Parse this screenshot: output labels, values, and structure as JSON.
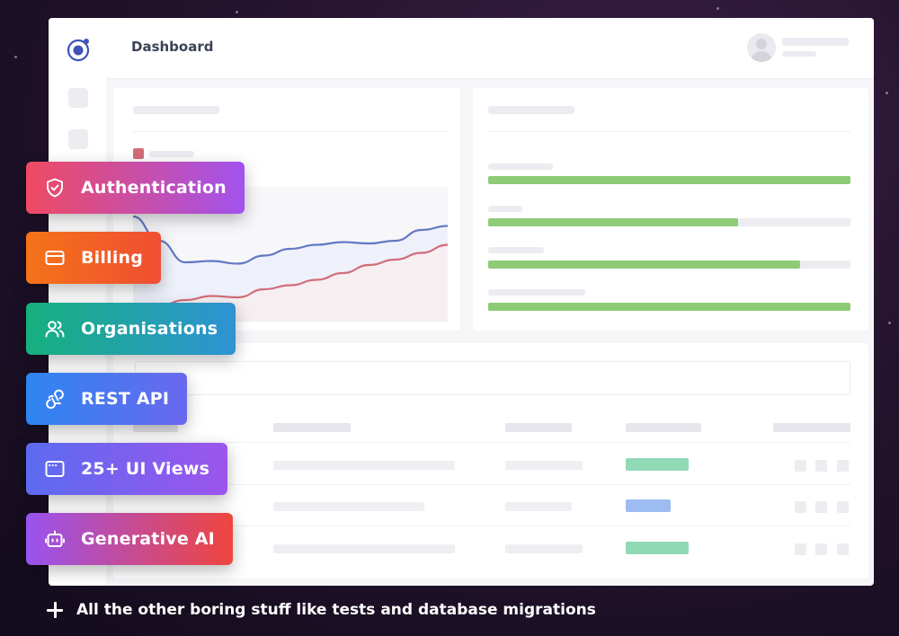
{
  "dashboard": {
    "title": "Dashboard"
  },
  "features": [
    {
      "label": "Authentication",
      "icon": "shield-check-icon"
    },
    {
      "label": "Billing",
      "icon": "credit-card-icon"
    },
    {
      "label": "Organisations",
      "icon": "users-icon"
    },
    {
      "label": "REST API",
      "icon": "webhook-icon"
    },
    {
      "label": "25+ UI Views",
      "icon": "window-icon"
    },
    {
      "label": "Generative AI",
      "icon": "robot-icon"
    }
  ],
  "footer": {
    "text": "All the other boring stuff like tests and database migrations",
    "icon": "plus-icon"
  },
  "colors": {
    "chart_upper_line": "#6478c4",
    "chart_lower_line": "#d26d79",
    "bar_fill": "#8ecb77",
    "status_green": "#8fd9b5",
    "status_blue": "#9cbcf2"
  },
  "progress_bars": [
    1.0,
    0.69,
    0.86,
    1.0
  ],
  "chart_data": {
    "type": "line",
    "x": [
      0,
      1,
      2,
      3,
      4,
      5,
      6,
      7,
      8,
      9,
      10,
      11,
      12
    ],
    "series": [
      {
        "values": [
          78,
          60,
          44,
          45,
          43,
          49,
          54,
          57,
          59,
          58,
          60,
          68,
          71
        ]
      },
      {
        "values": [
          8,
          12,
          16,
          19,
          18,
          24,
          27,
          31,
          36,
          42,
          46,
          51,
          57
        ]
      }
    ],
    "ylim": [
      0,
      100
    ],
    "grid": false
  },
  "table": {
    "rows": [
      {
        "status_color": "#8fd9b5",
        "status_fraction": 0.83
      },
      {
        "status_color": "#9cbcf2",
        "status_fraction": 0.6
      },
      {
        "status_color": "#8fd9b5",
        "status_fraction": 0.83
      }
    ]
  }
}
